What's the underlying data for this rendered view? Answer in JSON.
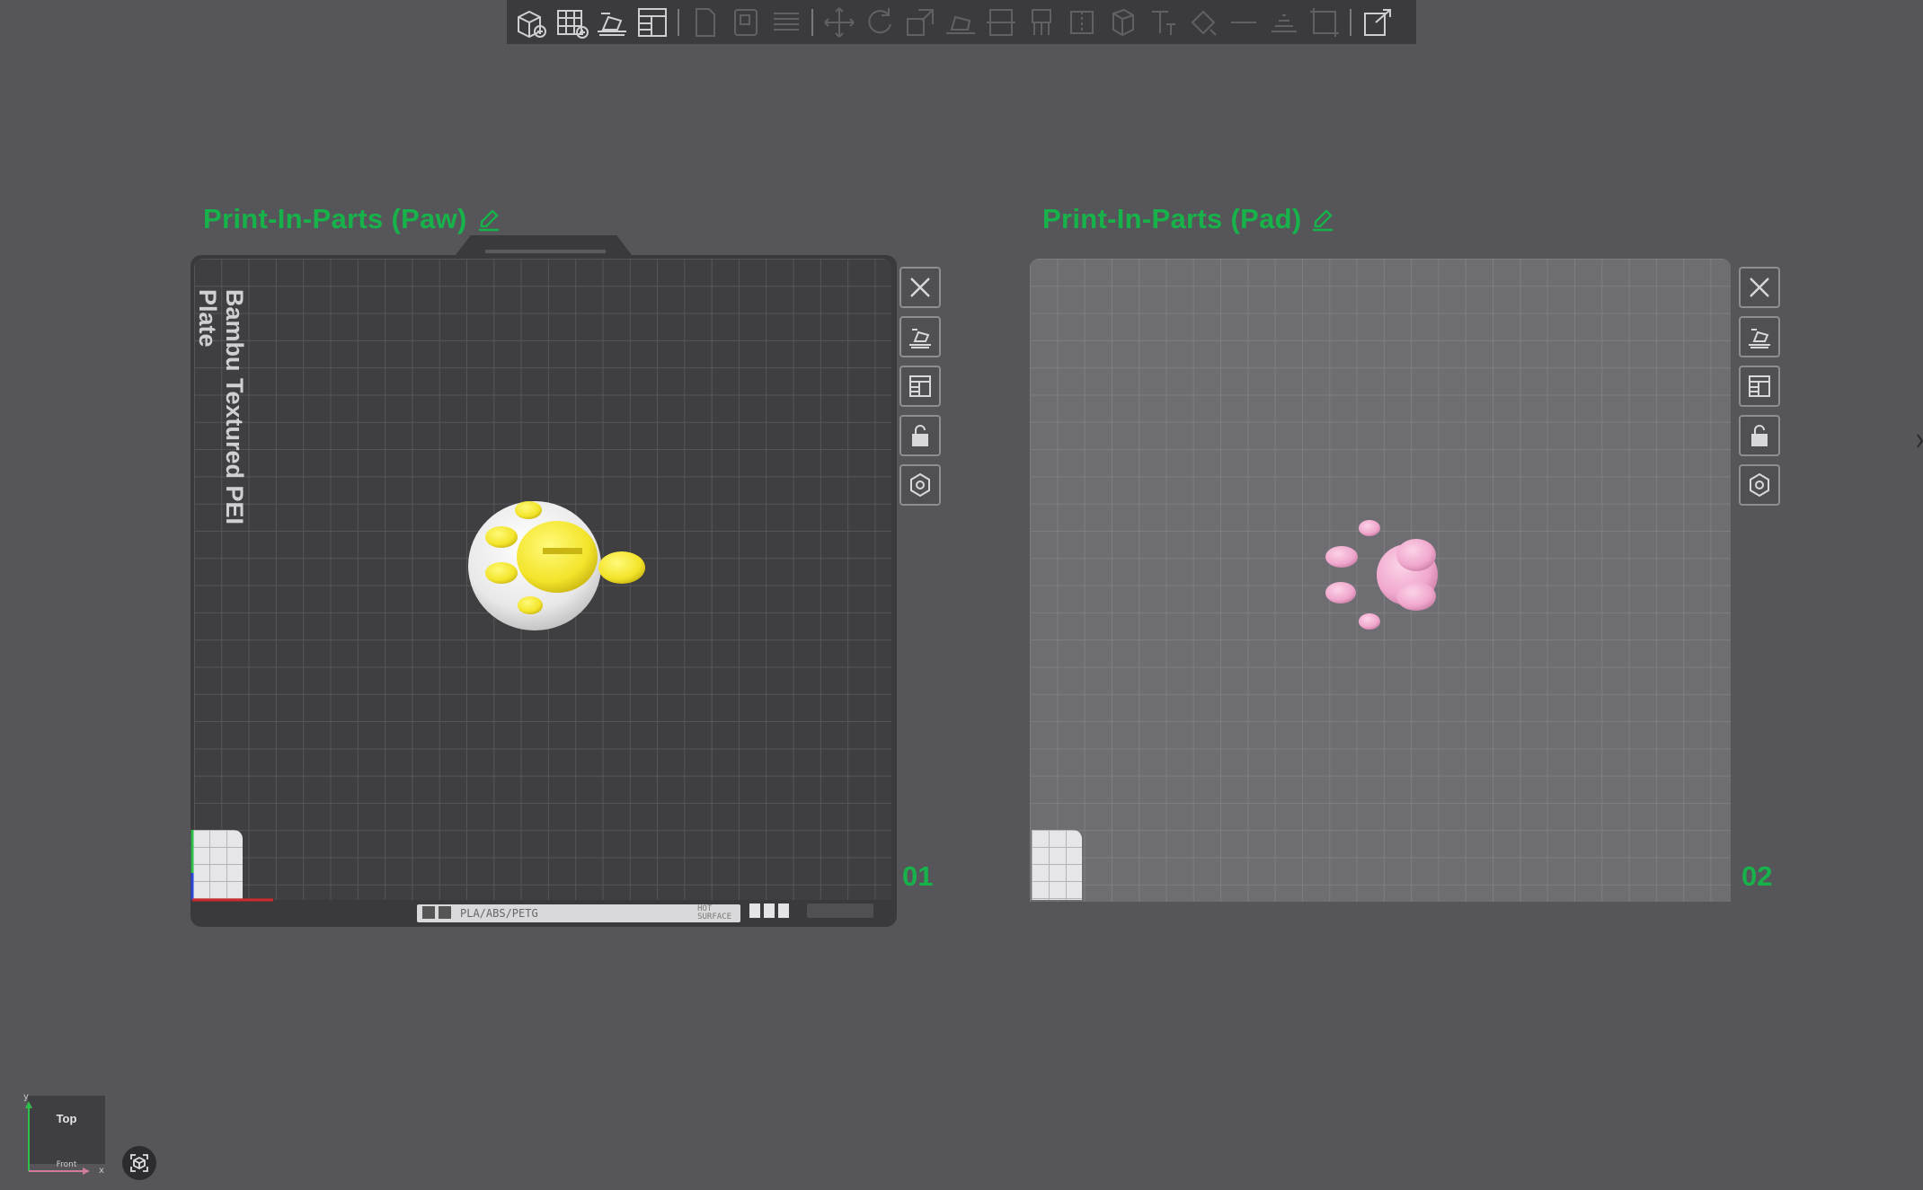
{
  "toolbar": {
    "groups": [
      [
        "add-cube-icon",
        "grid-icon",
        "slicer-icon",
        "layout-icon"
      ],
      [
        "page-icon",
        "page-blank-icon",
        "layers-icon"
      ],
      [
        "move-icon",
        "rotate-icon",
        "scale-icon",
        "lay-flat-icon",
        "cut-icon",
        "support-icon",
        "seam-icon",
        "color-paint-icon",
        "text-icon",
        "measure-icon",
        "assembly-icon",
        "split-icon",
        "ruler-icon"
      ],
      [
        "export-icon"
      ]
    ]
  },
  "plates": [
    {
      "title": "Print-In-Parts (Paw)",
      "number": "01",
      "plate_type": "Bambu Textured PEI Plate",
      "material": "PLA/ABS/PETG",
      "hot_surface_line1": "HOT",
      "hot_surface_line2": "SURFACE",
      "active": true
    },
    {
      "title": "Print-In-Parts (Pad)",
      "number": "02",
      "active": false
    }
  ],
  "plate_tools": [
    "close-icon",
    "arrange-icon",
    "orient-icon",
    "lock-icon",
    "settings-icon"
  ],
  "view_cube": {
    "face": "Top",
    "bottom": "Front",
    "axis_y": "y",
    "axis_x": "x"
  },
  "colors": {
    "accent_green": "#17b34a",
    "paw_yellow": "#ffee3a",
    "paw_white": "#f1f1f1",
    "pad_pink": "#f0a6cc",
    "background": "#55555a"
  }
}
